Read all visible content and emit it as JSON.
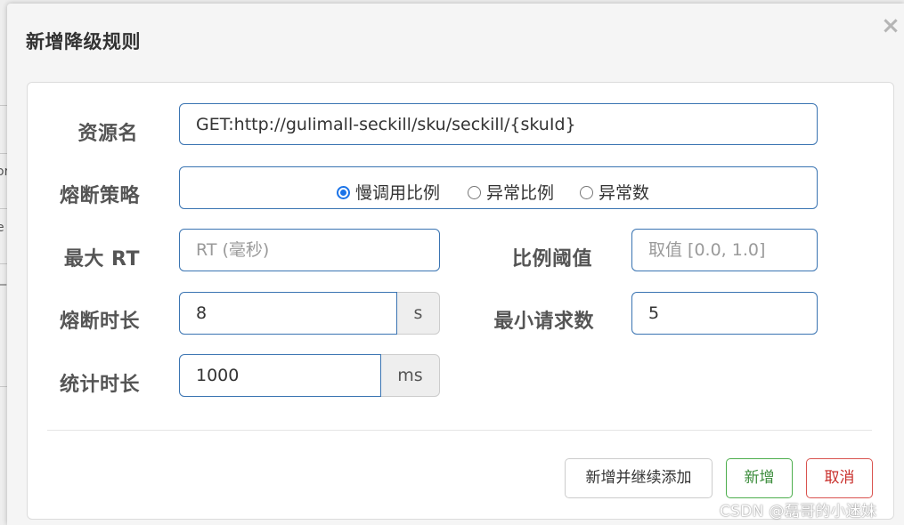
{
  "dialog": {
    "title": "新增降级规则",
    "close_label": "×"
  },
  "backdrop": {
    "fragments": [
      "or",
      "e",
      "—"
    ]
  },
  "form": {
    "resource": {
      "label": "资源名",
      "value": "GET:http://gulimall-seckill/sku/seckill/{skuId}"
    },
    "strategy": {
      "label": "熔断策略",
      "options": [
        {
          "label": "慢调用比例",
          "checked": true
        },
        {
          "label": "异常比例",
          "checked": false
        },
        {
          "label": "异常数",
          "checked": false
        }
      ]
    },
    "max_rt": {
      "label": "最大 RT",
      "value": "",
      "placeholder": "RT (毫秒)"
    },
    "ratio_threshold": {
      "label": "比例阈值",
      "value": "",
      "placeholder": "取值 [0.0, 1.0]"
    },
    "break_duration": {
      "label": "熔断时长",
      "value": "8",
      "unit": "s"
    },
    "min_requests": {
      "label": "最小请求数",
      "value": "5"
    },
    "stat_duration": {
      "label": "统计时长",
      "value": "1000",
      "unit": "ms"
    }
  },
  "footer": {
    "add_continue_label": "新增并继续添加",
    "add_label": "新增",
    "cancel_label": "取消"
  },
  "watermark": "CSDN @磊哥的小迷妹"
}
